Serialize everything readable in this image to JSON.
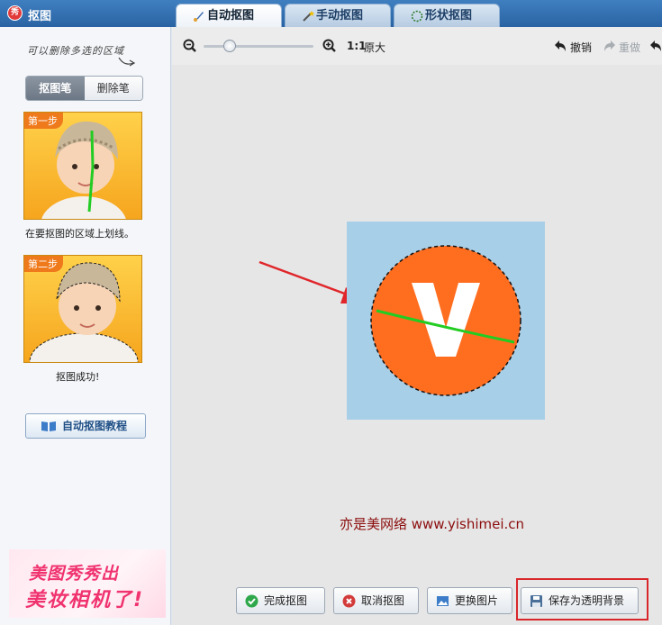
{
  "window": {
    "title": "抠图",
    "app_icon_text": "秀"
  },
  "tabs": [
    {
      "label": "自动抠图",
      "icon": "brush-icon",
      "active": true
    },
    {
      "label": "手动抠图",
      "icon": "magic-wand-icon",
      "active": false
    },
    {
      "label": "形状抠图",
      "icon": "dashed-shape-icon",
      "active": false
    }
  ],
  "sidebar": {
    "hint": "可以删除多选的区域",
    "modes": {
      "draw": "抠图笔",
      "erase": "删除笔"
    },
    "steps": [
      {
        "badge": "第一步",
        "caption": "在要抠图的区域上划线。"
      },
      {
        "badge": "第二步",
        "caption": "抠图成功!"
      }
    ],
    "tutorial_button": "自动抠图教程",
    "promo": {
      "line1": "美图秀秀出",
      "line2": "美妆相机了!"
    }
  },
  "toolbar": {
    "ratio": "1:1",
    "ratio_label": "原大",
    "undo": "撤销",
    "redo": "重做"
  },
  "canvas": {
    "image_letter": "V",
    "watermark": "亦是美网络 www.yishimei.cn"
  },
  "actions": {
    "done": "完成抠图",
    "cancel": "取消抠图",
    "replace": "更换图片",
    "save_transparent": "保存为透明背景"
  },
  "colors": {
    "accent": "#2a63a3",
    "image_bg": "#a8cfe8",
    "circle": "#ff6d1f",
    "stroke": "#22cc22",
    "highlight": "#d9262b"
  }
}
